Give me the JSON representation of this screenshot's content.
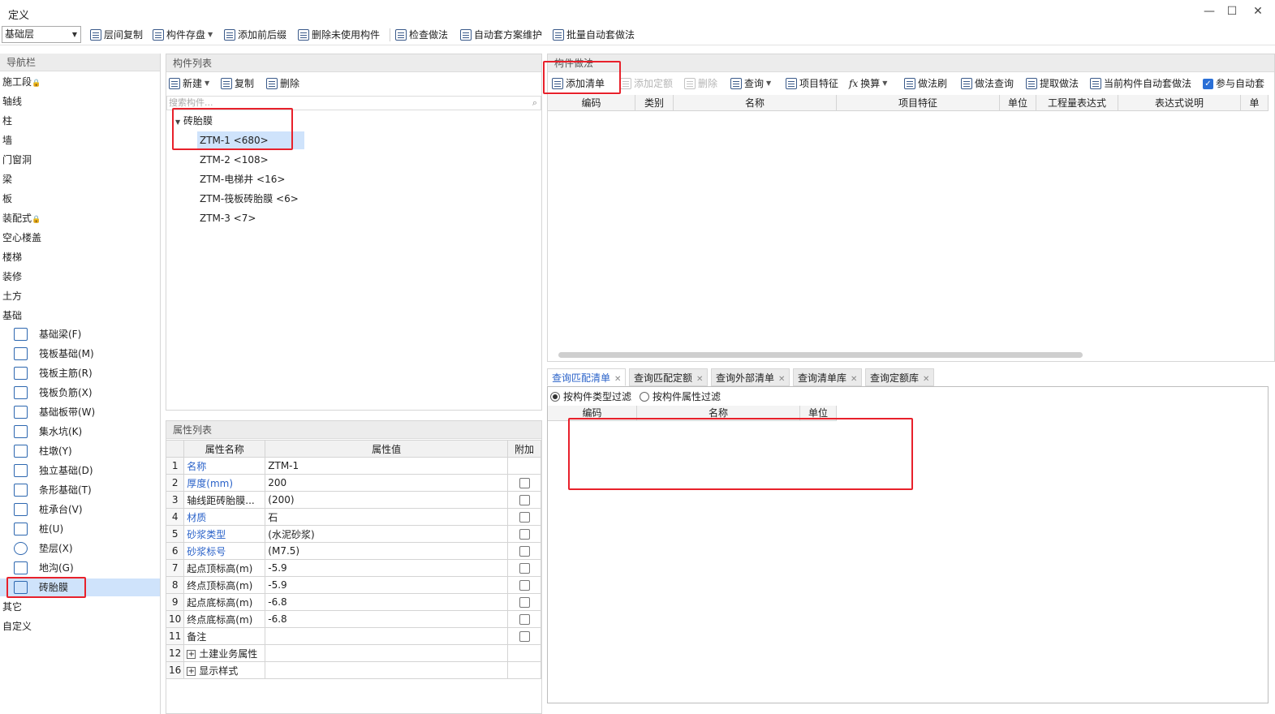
{
  "window": {
    "title": "定义",
    "minimize": "—",
    "maximize": "☐",
    "close": "✕"
  },
  "toolbar": {
    "floor": "基础层",
    "items": [
      "层间复制",
      "构件存盘",
      "添加前后缀",
      "删除未使用构件",
      "检查做法",
      "自动套方案维护",
      "批量自动套做法"
    ]
  },
  "nav": {
    "header": "导航栏",
    "items": [
      "施工段",
      "轴线",
      "柱",
      "墙",
      "门窗洞",
      "梁",
      "板",
      "装配式",
      "空心楼盖",
      "楼梯",
      "装修",
      "土方",
      "基础"
    ],
    "sub": [
      "基础梁(F)",
      "筏板基础(M)",
      "筏板主筋(R)",
      "筏板负筋(X)",
      "基础板带(W)",
      "集水坑(K)",
      "柱墩(Y)",
      "独立基础(D)",
      "条形基础(T)",
      "桩承台(V)",
      "桩(U)",
      "垫层(X)",
      "地沟(G)",
      "砖胎膜"
    ],
    "tail": [
      "其它",
      "自定义"
    ]
  },
  "complist": {
    "header": "构件列表",
    "new": "新建",
    "copy": "复制",
    "delete": "删除",
    "search_placeholder": "搜索构件...",
    "root": "砖胎膜",
    "children": [
      "ZTM-1 <680>",
      "ZTM-2 <108>",
      "ZTM-电梯井 <16>",
      "ZTM-筏板砖胎膜 <6>",
      "ZTM-3 <7>"
    ]
  },
  "props": {
    "header": "属性列表",
    "col_name": "属性名称",
    "col_value": "属性值",
    "col_extra": "附加",
    "rows": [
      {
        "n": "1",
        "name": "名称",
        "value": "ZTM-1"
      },
      {
        "n": "2",
        "name": "厚度(mm)",
        "value": "200"
      },
      {
        "n": "3",
        "name": "轴线距砖胎膜...",
        "value": "(200)"
      },
      {
        "n": "4",
        "name": "材质",
        "value": "石"
      },
      {
        "n": "5",
        "name": "砂浆类型",
        "value": "(水泥砂浆)"
      },
      {
        "n": "6",
        "name": "砂浆标号",
        "value": "(M7.5)"
      },
      {
        "n": "7",
        "name": "起点顶标高(m)",
        "value": "-5.9"
      },
      {
        "n": "8",
        "name": "终点顶标高(m)",
        "value": "-5.9"
      },
      {
        "n": "9",
        "name": "起点底标高(m)",
        "value": "-6.8"
      },
      {
        "n": "10",
        "name": "终点底标高(m)",
        "value": "-6.8"
      },
      {
        "n": "11",
        "name": "备注",
        "value": ""
      },
      {
        "n": "12",
        "name": "土建业务属性",
        "value": ""
      },
      {
        "n": "16",
        "name": "显示样式",
        "value": ""
      }
    ]
  },
  "method": {
    "header": "构件做法",
    "tools": [
      "添加清单",
      "添加定额",
      "删除",
      "查询",
      "项目特征",
      "换算",
      "做法刷",
      "做法查询",
      "提取做法",
      "当前构件自动套做法",
      "参与自动套"
    ],
    "fx": "fx",
    "columns": [
      "编码",
      "类别",
      "名称",
      "项目特征",
      "单位",
      "工程量表达式",
      "表达式说明",
      "单"
    ]
  },
  "query": {
    "tabs": [
      "查询匹配清单",
      "查询匹配定额",
      "查询外部清单",
      "查询清单库",
      "查询定额库"
    ],
    "filter1": "按构件类型过滤",
    "filter2": "按构件属性过滤",
    "columns": [
      "编码",
      "名称",
      "单位"
    ]
  }
}
